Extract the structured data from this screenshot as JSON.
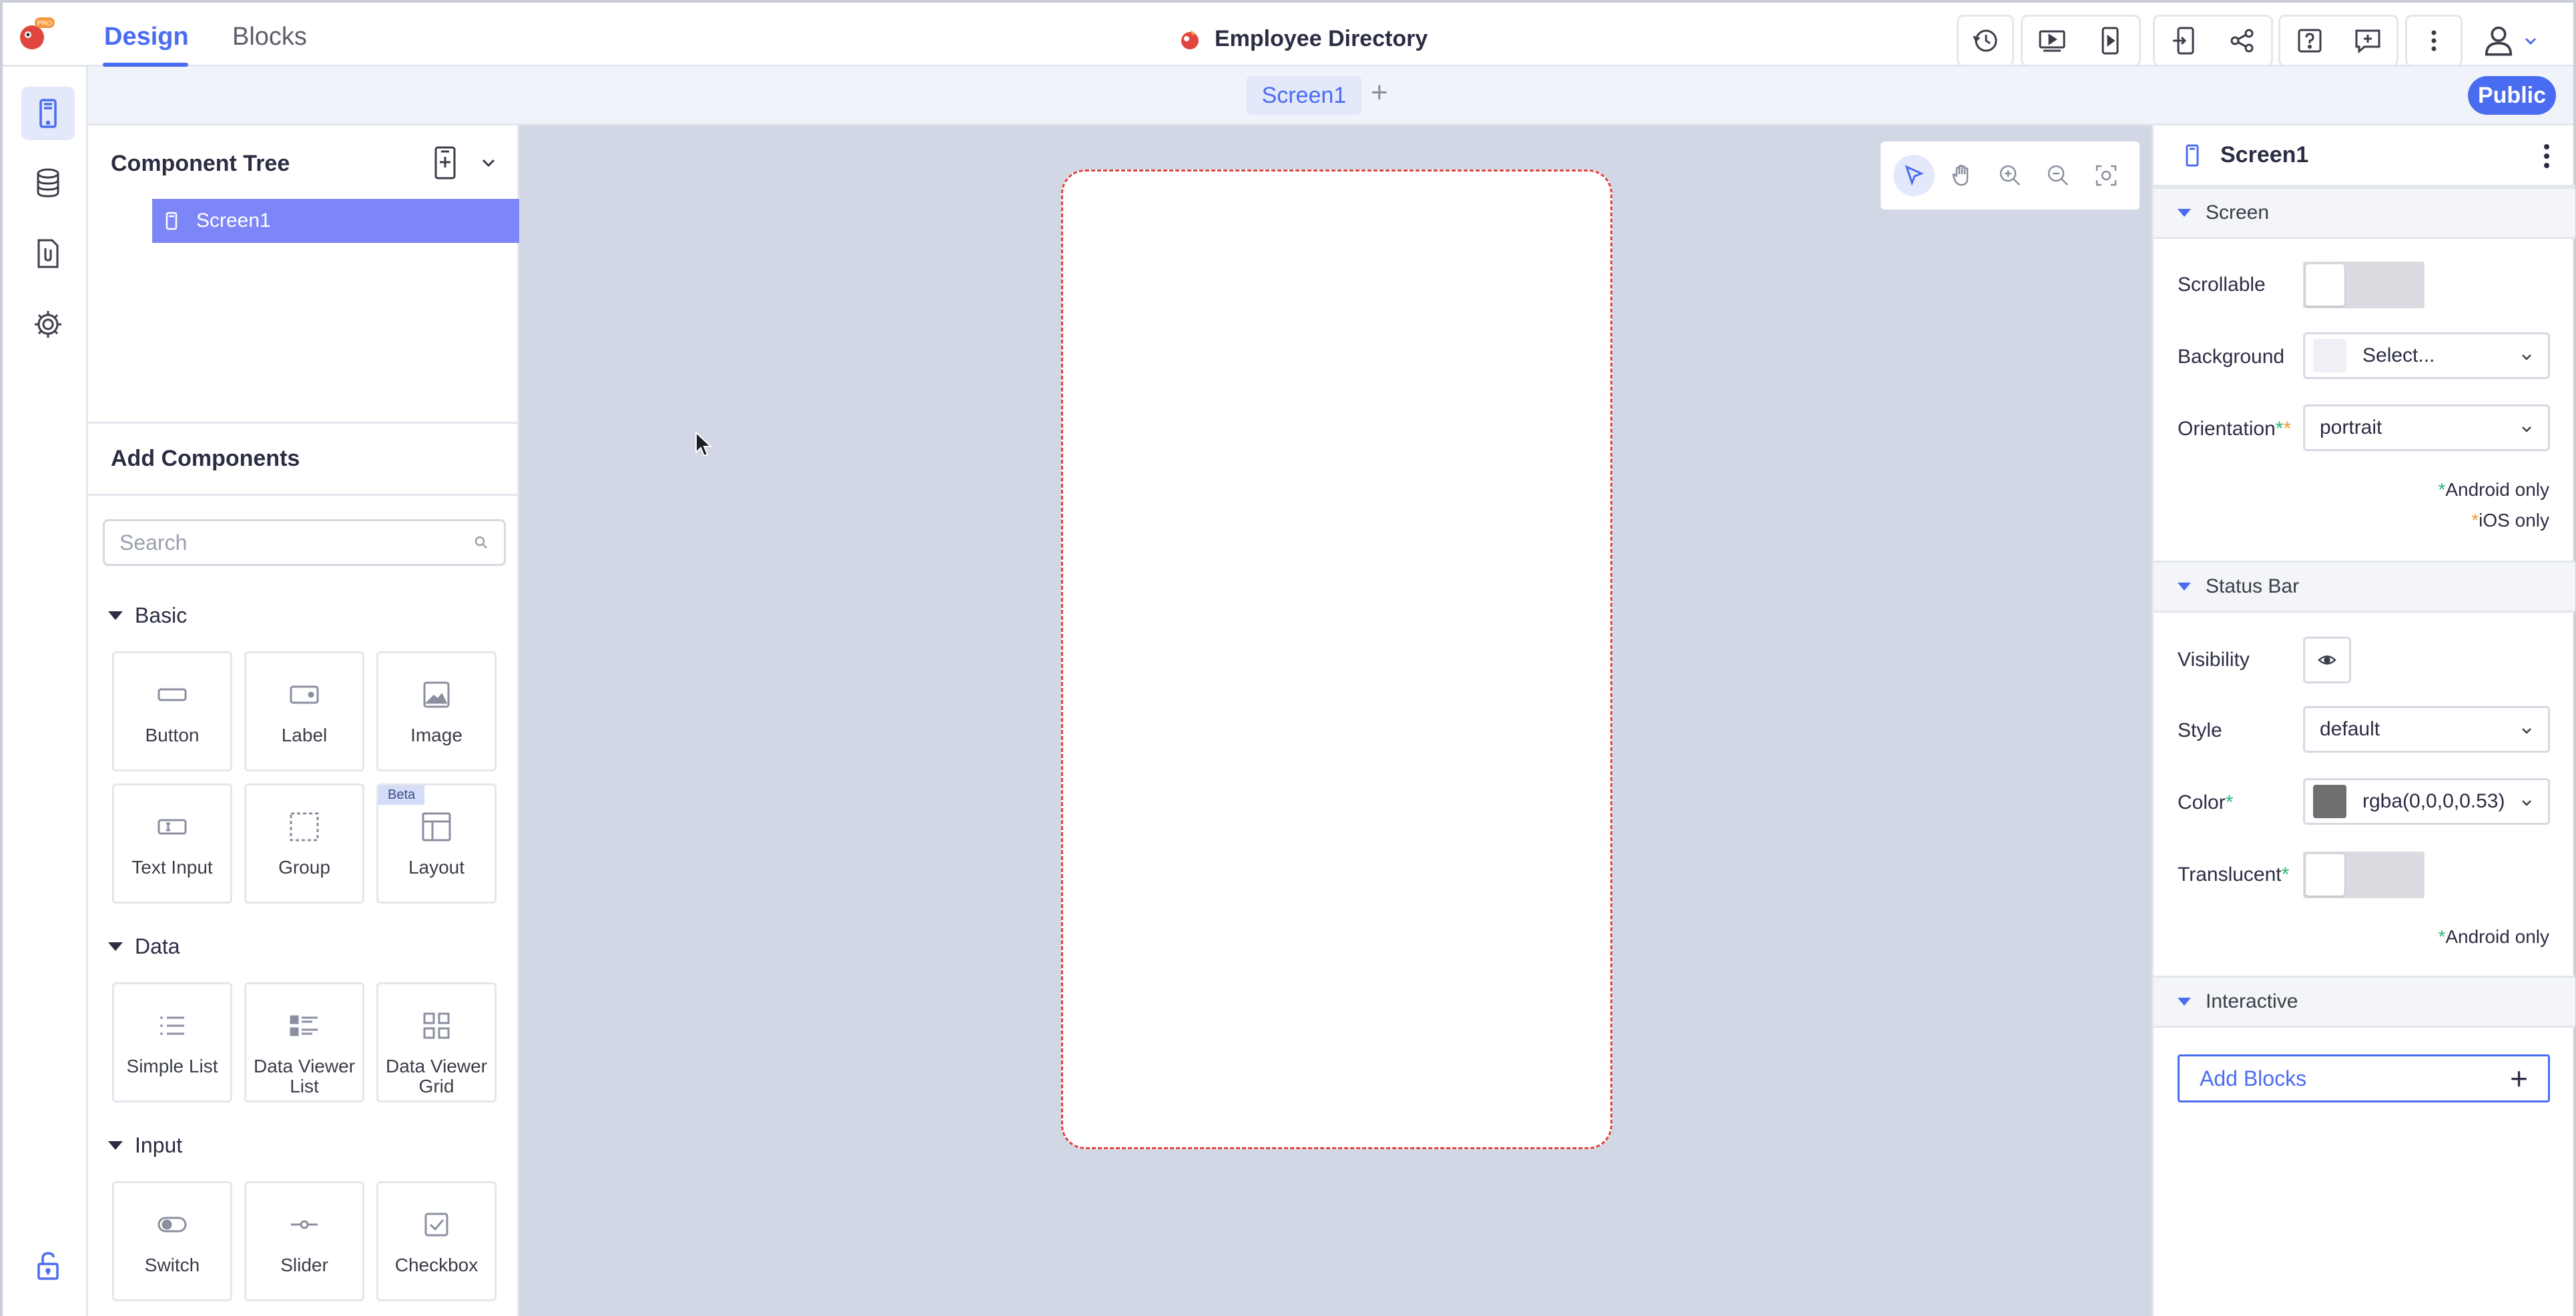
{
  "topbar": {
    "logo_badge": "PRO",
    "tabs": [
      "Design",
      "Blocks"
    ],
    "active_tab": "Design",
    "app_title": "Employee Directory",
    "accent_color": "#4a6cf0"
  },
  "screen_tabs": {
    "current": "Screen1",
    "add_label": "+",
    "visibility_badge": "Public"
  },
  "component_tree": {
    "title": "Component Tree",
    "items": [
      {
        "label": "Screen1"
      }
    ]
  },
  "add_components": {
    "title": "Add Components",
    "search_placeholder": "Search",
    "categories": [
      {
        "name": "Basic",
        "items": [
          "Button",
          "Label",
          "Image",
          "Text Input",
          "Group",
          "Layout"
        ]
      },
      {
        "name": "Data",
        "items": [
          "Simple List",
          "Data Viewer List",
          "Data Viewer Grid"
        ]
      },
      {
        "name": "Input",
        "items": [
          "Switch",
          "Slider",
          "Checkbox"
        ]
      }
    ],
    "beta_label": "Beta"
  },
  "properties": {
    "title": "Screen1",
    "sections": {
      "screen": "Screen",
      "status_bar": "Status Bar",
      "interactive": "Interactive"
    },
    "scrollable_label": "Scrollable",
    "scrollable_on": false,
    "background_label": "Background",
    "background_value": "Select...",
    "orientation_label": "Orientation",
    "orientation_value": "portrait",
    "android_only": "Android only",
    "ios_only": "iOS only",
    "visibility_label": "Visibility",
    "style_label": "Style",
    "style_value": "default",
    "color_label": "Color",
    "color_value": "rgba(0,0,0,0.53)",
    "translucent_label": "Translucent",
    "translucent_on": false,
    "android_only_2": "Android only",
    "add_blocks_label": "Add Blocks",
    "add_blocks_plus": "+"
  }
}
